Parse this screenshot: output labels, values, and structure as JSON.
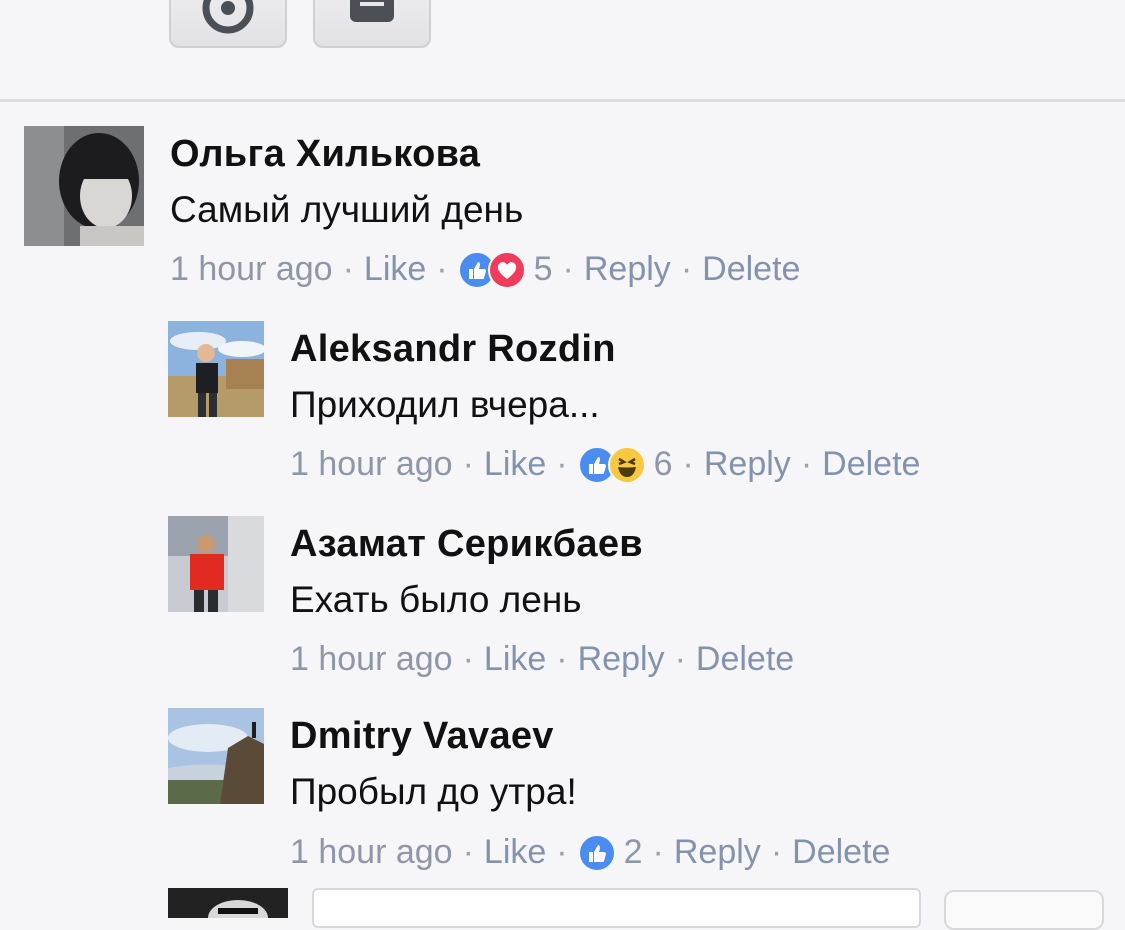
{
  "colors": {
    "background": "#f6f6f8",
    "meta_text": "#8e97a8",
    "link": "#8393ad",
    "like": "#4a8cf0",
    "love": "#f03b5a",
    "haha": "#f7c940"
  },
  "toolbar": {
    "icons": [
      "smiley-icon",
      "camera-icon"
    ]
  },
  "comments": [
    {
      "name": "Ольга Хилькова",
      "text": "Самый лучший день",
      "time": "1 hour ago",
      "like": "Like",
      "reactions": [
        "like",
        "love"
      ],
      "count": "5",
      "reply": "Reply",
      "delete": "Delete"
    },
    {
      "name": "Aleksandr Rozdin",
      "text": "Приходил вчера...",
      "time": "1 hour ago",
      "like": "Like",
      "reactions": [
        "like",
        "haha"
      ],
      "count": "6",
      "reply": "Reply",
      "delete": "Delete"
    },
    {
      "name": "Азамат Серикбаев",
      "text": "Ехать было лень",
      "time": "1 hour ago",
      "like": "Like",
      "reactions": [],
      "count": "",
      "reply": "Reply",
      "delete": "Delete"
    },
    {
      "name": "Dmitry Vavaev",
      "text": "Пробыл до утра!",
      "time": "1 hour ago",
      "like": "Like",
      "reactions": [
        "like"
      ],
      "count": "2",
      "reply": "Reply",
      "delete": "Delete"
    }
  ],
  "sep": "·"
}
